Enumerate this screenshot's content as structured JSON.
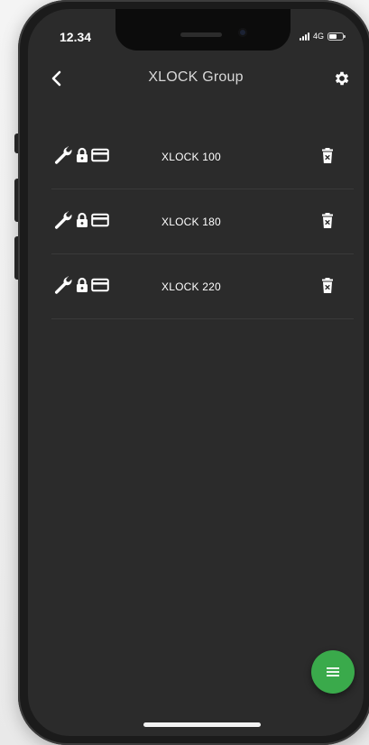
{
  "status_bar": {
    "time": "12.34",
    "network": "4G"
  },
  "header": {
    "title": "XLOCK Group",
    "back_icon": "chevron-left-icon",
    "settings_icon": "gear-icon"
  },
  "locks": [
    {
      "name": "XLOCK 100",
      "icons": [
        "wrench-icon",
        "padlock-icon",
        "card-icon"
      ],
      "action_icon": "trash-icon"
    },
    {
      "name": "XLOCK 180",
      "icons": [
        "wrench-icon",
        "padlock-icon",
        "card-icon"
      ],
      "action_icon": "trash-icon"
    },
    {
      "name": "XLOCK 220",
      "icons": [
        "wrench-icon",
        "padlock-icon",
        "card-icon"
      ],
      "action_icon": "trash-icon"
    }
  ],
  "fab": {
    "icon": "menu-icon",
    "color": "#3aaa4b"
  },
  "colors": {
    "screen_background": "#2b2b2b",
    "divider": "#3a3a3a",
    "text": "#ffffff",
    "accent": "#3aaa4b"
  }
}
